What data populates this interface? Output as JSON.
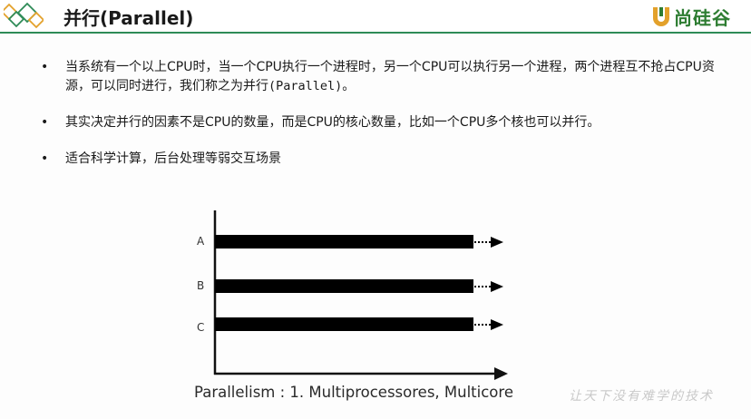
{
  "header": {
    "title": "并行(Parallel)",
    "logo_text": "尚硅谷",
    "accent_color": "#2e8b57"
  },
  "bullets": [
    {
      "text_a": "当系统有一个以上CPU时，当一个CPU执行一个进程时，另一个CPU可以执行另一个进程，两个进程互不抢占CPU资源，可以同时进行，我们称之为并行",
      "mono": "(Parallel)",
      "text_b": "。"
    },
    {
      "text": "其实决定并行的因素不是CPU的数量，而是CPU的核心数量，比如一个CPU多个核也可以并行。"
    },
    {
      "text": "适合科学计算，后台处理等弱交互场景"
    }
  ],
  "bullet_symbol": "•",
  "diagram": {
    "rows": [
      "A",
      "B",
      "C"
    ],
    "caption": "Parallelism : 1. Multiprocessores, Multicore"
  },
  "watermark": "让天下没有难学的技术"
}
